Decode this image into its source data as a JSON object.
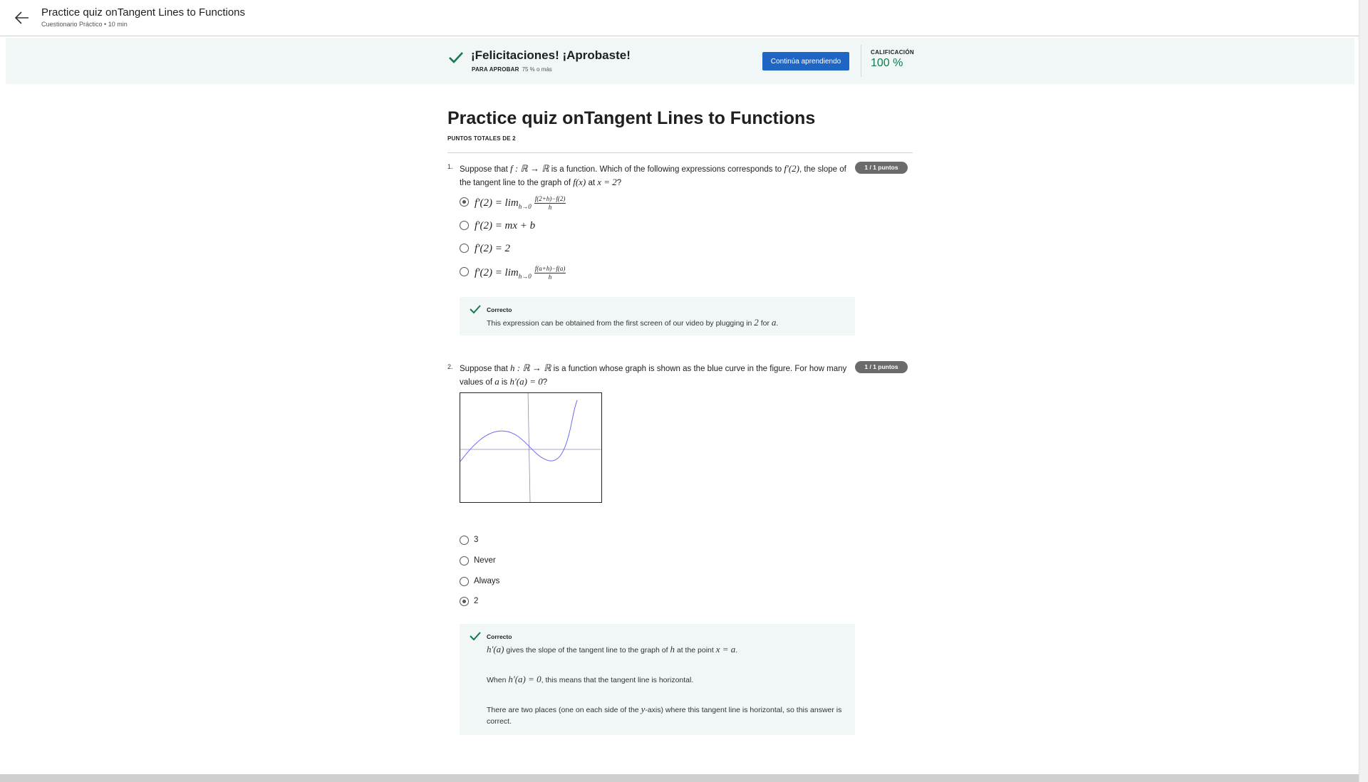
{
  "header": {
    "title": "Practice quiz onTangent Lines to Functions",
    "subtitle": "Cuestionario Práctico • 10 min",
    "back_icon": "arrow-left-icon"
  },
  "banner": {
    "title": "¡Felicitaciones! ¡Aprobaste!",
    "pass_label": "PARA APROBAR",
    "pass_value": "75 % o más",
    "continue_label": "Continúa aprendiendo",
    "grade_label": "CALIFICACIÓN",
    "grade_value": "100 %",
    "accent_color": "#137a4e",
    "button_color": "#1f66c4"
  },
  "quiz": {
    "title": "Practice quiz onTangent Lines to Functions",
    "points_total": "PUNTOS TOTALES DE 2"
  },
  "questions": [
    {
      "number": "1.",
      "points": "1 / 1 puntos",
      "text_parts": [
        "Suppose that ",
        "f : ℝ → ℝ",
        " is a function. Which of the following expressions corresponds to ",
        "f′(2)",
        ", the slope of the tangent line to the graph of ",
        "f(x)",
        " at ",
        "x = 2",
        "?"
      ],
      "options": [
        {
          "prefix": "f′(2) = lim",
          "sub": "h→0",
          "numerator": "f(2+h)−f(2)",
          "denominator": "h",
          "selected": true
        },
        {
          "text": "f′(2) = mx + b",
          "selected": false
        },
        {
          "text": "f′(2) = 2",
          "selected": false
        },
        {
          "prefix": "f′(2) = lim",
          "sub": "h→0",
          "numerator": "f(a+h)−f(a)",
          "denominator": "h",
          "selected": false
        }
      ],
      "feedback": {
        "label": "Correcto",
        "text_parts": [
          "This expression can be obtained from the first screen of our video by plugging in ",
          "2",
          " for ",
          "a",
          "."
        ]
      }
    },
    {
      "number": "2.",
      "points": "1 / 1 puntos",
      "text_parts": [
        "Suppose that ",
        "h : ℝ → ℝ",
        " is a function whose graph is shown as the blue curve in the figure. For how many values of ",
        "a",
        " is ",
        "h′(a) = 0",
        "?"
      ],
      "options": [
        {
          "text": "3",
          "selected": false
        },
        {
          "text": "Never",
          "selected": false
        },
        {
          "text": "Always",
          "selected": false
        },
        {
          "text": "2",
          "selected": true
        }
      ],
      "feedback": {
        "label": "Correcto",
        "p1_parts": [
          "h′(a)",
          " gives the slope of the tangent line to the graph of ",
          "h",
          " at the point ",
          "x = a",
          "."
        ],
        "p2_parts": [
          "When ",
          "h′(a) = 0",
          ", this means that the tangent line is horizontal."
        ],
        "p3_parts": [
          "There are two places (one on each side of the ",
          "y",
          "-axis) where this tangent line is horizontal, so this answer is correct."
        ]
      }
    }
  ],
  "icons": {
    "check": "check-icon"
  },
  "colors": {
    "banner_bg": "#f1f7f6",
    "curve": "#6b6bf0",
    "badge": "#6b6b6b"
  }
}
